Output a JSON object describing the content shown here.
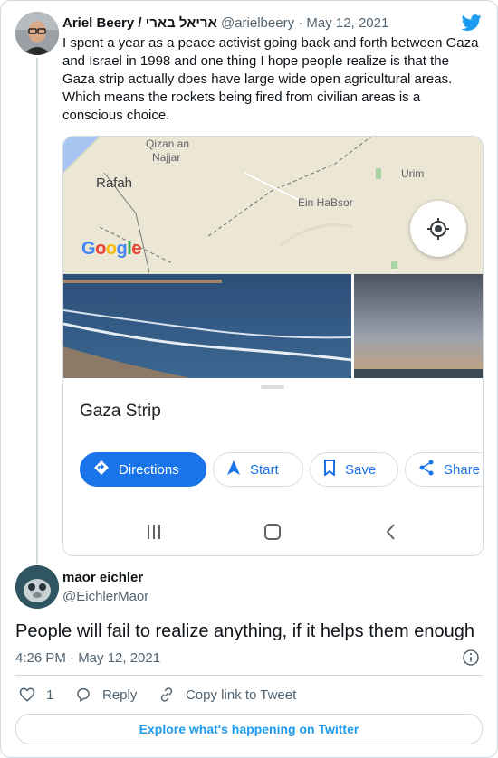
{
  "tweet": {
    "author_name": "Ariel Beery / אריאל בארי",
    "handle": "@arielbeery",
    "separator": "·",
    "date": "May 12, 2021",
    "text": "I spent a year as a peace activist going back and forth between Gaza and Israel in 1998 and one thing I hope people realize is that the Gaza strip actually does have large wide open agricultural areas. Which means the rockets being fired from civilian areas is a conscious choice.",
    "media": {
      "map_labels": {
        "qizan": "Qizan an",
        "najjar": "Najjar",
        "rafah": "Rafah",
        "ein_habsor": "Ein HaBsor",
        "urim": "Urim"
      },
      "google_logo": "Google",
      "place_name": "Gaza Strip",
      "chips": {
        "directions": "Directions",
        "start": "Start",
        "save": "Save",
        "share": "Share"
      },
      "icons": [
        "my-location-icon",
        "directions-icon",
        "navigation-arrow-icon",
        "bookmark-icon",
        "share-icon",
        "android-recents-icon",
        "android-home-icon",
        "android-back-icon"
      ]
    }
  },
  "reply": {
    "author_name": "maor eichler",
    "handle": "@EichlerMaor",
    "text": "People will fail to realize anything, if it helps them enough",
    "time": "4:26 PM · May 12, 2021",
    "like_count": "1",
    "reply_label": "Reply",
    "copy_label": "Copy link to Tweet",
    "explore_label": "Explore what's happening on Twitter"
  },
  "colors": {
    "twitter_blue": "#1d9bf0",
    "google_blue": "#1a73e8",
    "text_primary": "#0f1419",
    "text_secondary": "#536471",
    "border": "#cfd9de"
  }
}
